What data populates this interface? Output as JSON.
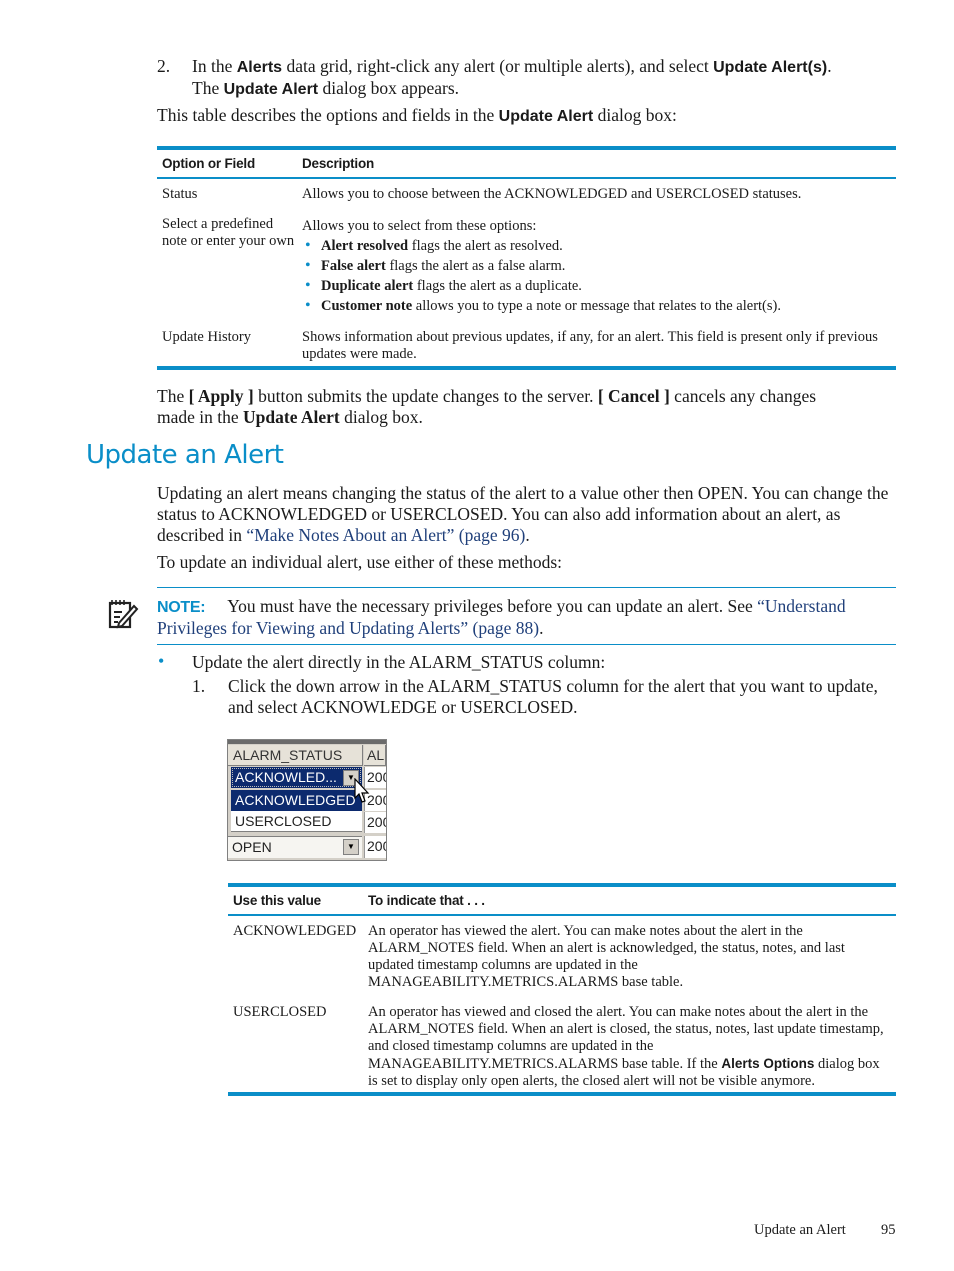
{
  "step2": {
    "number": "2.",
    "line1_pre": "In the ",
    "line1_b1": "Alerts",
    "line1_mid": " data grid, right-click any alert (or multiple alerts), and select ",
    "line1_b2": "Update Alert(s)",
    "line1_end": ".",
    "line2_pre": "The ",
    "line2_b": "Update Alert",
    "line2_end": " dialog box appears."
  },
  "intro": {
    "pre": "This table describes the options and fields in the ",
    "bold": "Update Alert",
    "end": " dialog box:"
  },
  "options_table": {
    "headers": [
      "Option or Field",
      "Description"
    ],
    "rows": [
      {
        "field": "Status",
        "description": "Allows you to choose between the ACKNOWLEDGED and USERCLOSED statuses."
      },
      {
        "field": "Select a predefined note or enter your own",
        "description": "Allows you to select from these options:",
        "bullets": [
          {
            "bold": "Alert resolved",
            "text": " flags the alert as resolved."
          },
          {
            "bold": "False alert",
            "text": " flags the alert as a false alarm."
          },
          {
            "bold": "Duplicate alert",
            "text": " flags the alert as a duplicate."
          },
          {
            "bold": "Customer note",
            "text": " allows you to type a note or message that relates to the alert(s)."
          }
        ]
      },
      {
        "field": "Update History",
        "description": "Shows information about previous updates, if any, for an alert. This field is present only if previous updates were made."
      }
    ]
  },
  "apply_para": {
    "t1": "The ",
    "b1": "[ Apply ]",
    "t2": " button submits the update changes to the server. ",
    "b2": "[ Cancel ]",
    "t3": " cancels any changes",
    "t4": "made in the ",
    "b3": "Update Alert",
    "t5": " dialog box."
  },
  "section": {
    "title": "Update an Alert",
    "para1_a": "Updating an alert means changing the status of the alert to a value other then OPEN. You can change the status to ACKNOWLEDGED or USERCLOSED. You can also add information about an alert, as described in ",
    "para1_link": "“Make Notes About an Alert” (page 96)",
    "para1_end": ".",
    "para2": "To update an individual alert, use either of these methods:"
  },
  "note": {
    "icon": "note-pencil-icon",
    "label": "NOTE:",
    "text": "You must have the necessary privileges before you can update an alert. See ",
    "link": "“Understand Privileges for Viewing and Updating Alerts” (page 88)",
    "end": "."
  },
  "method": {
    "bullet": "•",
    "text": "Update the alert directly in the ALARM_STATUS column:",
    "sub_number": "1.",
    "sub_text": "Click the down arrow in the ALARM_STATUS column for the alert that you want to update, and select ACKNOWLEDGE or USERCLOSED."
  },
  "grid_screenshot": {
    "col1_header": "ALARM_STATUS",
    "col2_header": "AL",
    "current_value": "ACKNOWLED...",
    "dropdown_options": [
      "ACKNOWLEDGED",
      "USERCLOSED"
    ],
    "selected_option": "ACKNOWLEDGED",
    "next_row_value": "OPEN",
    "date_prefix": "200",
    "colors": {
      "selection": "#0c2a6e",
      "chrome": "#d4d0c8"
    }
  },
  "values_table": {
    "headers": [
      "Use this value",
      "To indicate that . . ."
    ],
    "rows": [
      {
        "value": "ACKNOWLEDGED",
        "text": "An operator has viewed the alert. You can make notes about the alert in the ALARM_NOTES field. When an alert is acknowledged, the status, notes, and last updated timestamp columns are updated in the MANAGEABILITY.METRICS.ALARMS base table."
      },
      {
        "value": "USERCLOSED",
        "text_a": "An operator has viewed and closed the alert. You can make notes about the alert in the ALARM_NOTES field. When an alert is closed, the status, notes, last update timestamp, and closed timestamp columns are updated in the MANAGEABILITY.METRICS.ALARMS base table. If the ",
        "text_bold": "Alerts Options",
        "text_b": " dialog box is set to display only open alerts, the closed alert will not be visible anymore."
      }
    ]
  },
  "footer": {
    "section": "Update an Alert",
    "page": "95"
  },
  "colors": {
    "accent": "#0a8ec8",
    "link": "#1f3f7a"
  }
}
